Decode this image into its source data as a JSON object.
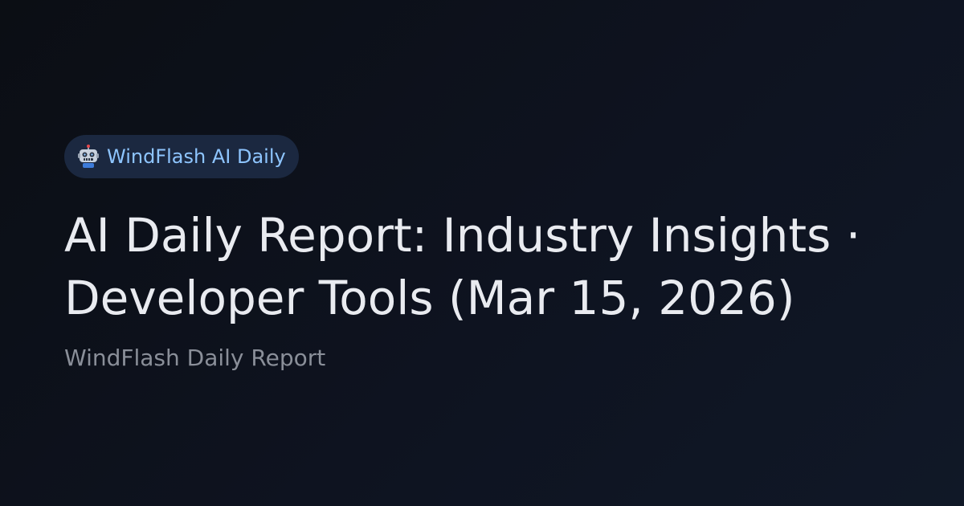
{
  "badge": {
    "icon": "robot-icon",
    "label": "WindFlash AI Daily"
  },
  "title": "AI Daily Report: Industry Insights · Developer Tools (Mar 15, 2026)",
  "subtitle": "WindFlash Daily Report",
  "colors": {
    "background": "#0e1320",
    "badge_background": "#1b2840",
    "badge_text": "#8ec5ff",
    "title": "#e9ebf0",
    "subtitle": "#8a8f99"
  }
}
